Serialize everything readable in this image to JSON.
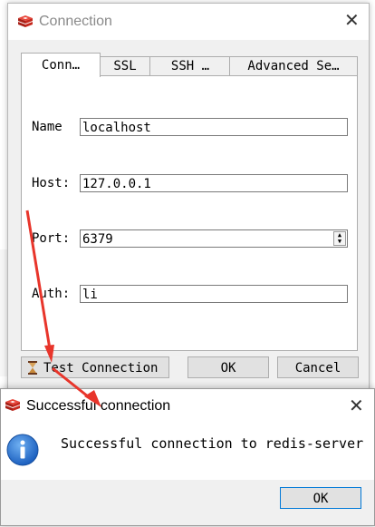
{
  "connection_dialog": {
    "title": "Connection",
    "tabs": [
      {
        "label": "Conn…"
      },
      {
        "label": "SSL"
      },
      {
        "label": "SSH …"
      },
      {
        "label": "Advanced Se…"
      }
    ],
    "fields": {
      "name": {
        "label": "Name",
        "value": "localhost"
      },
      "host": {
        "label": "Host:",
        "value": "127.0.0.1"
      },
      "port": {
        "label": "Port:",
        "value": "6379"
      },
      "auth": {
        "label": "Auth:",
        "value": "li"
      }
    },
    "buttons": {
      "test": "Test Connection",
      "ok": "OK",
      "cancel": "Cancel"
    }
  },
  "success_dialog": {
    "title": "Successful connection",
    "message": "Successful connection to redis-server",
    "ok": "OK"
  },
  "colors": {
    "redis_red": "#d82c20",
    "info_blue": "#1f6fd1",
    "annotation_arrow": "#e8352b",
    "focus_border": "#0078d7"
  }
}
